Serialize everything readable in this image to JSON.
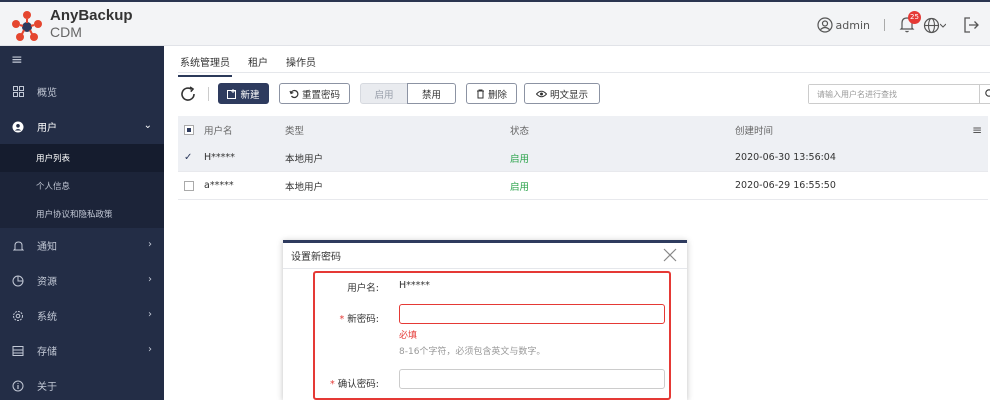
{
  "header": {
    "brand_name": "AnyBackup",
    "brand_sub": "CDM",
    "user": "admin",
    "notification_count": "25"
  },
  "sidebar": {
    "items": [
      {
        "label": "概览",
        "icon": "grid-icon"
      },
      {
        "label": "用户",
        "icon": "user-icon",
        "expanded": true
      },
      {
        "label": "通知",
        "icon": "bell-icon"
      },
      {
        "label": "资源",
        "icon": "pie-chart-icon"
      },
      {
        "label": "系统",
        "icon": "gear-icon"
      },
      {
        "label": "存储",
        "icon": "storage-icon"
      },
      {
        "label": "关于",
        "icon": "info-icon"
      }
    ],
    "sub_items": [
      "用户列表",
      "个人信息",
      "用户协议和隐私政策"
    ],
    "selected_sub": "用户列表"
  },
  "tabs": [
    "系统管理员",
    "租户",
    "操作员"
  ],
  "active_tab": "系统管理员",
  "toolbar": {
    "new_label": "新建",
    "reset_password_label": "重置密码",
    "enable_label": "启用",
    "disable_label": "禁用",
    "delete_label": "删除",
    "show_plain_label": "明文显示",
    "search_placeholder": "请输入用户名进行查找"
  },
  "table": {
    "columns": [
      "用户名",
      "类型",
      "状态",
      "创建时间"
    ],
    "rows": [
      {
        "name": "H*****",
        "type": "本地用户",
        "status": "启用",
        "created": "2020-06-30 13:56:04",
        "selected": true
      },
      {
        "name": "a*****",
        "type": "本地用户",
        "status": "启用",
        "created": "2020-06-29 16:55:50",
        "selected": false
      }
    ]
  },
  "dialog": {
    "title": "设置新密码",
    "username_label": "用户名:",
    "username_value": "H*****",
    "new_password_label": "新密码:",
    "new_password_value": "",
    "required_error": "必填",
    "password_hint": "8-16个字符，必须包含英文与数字。",
    "confirm_password_label": "确认密码:",
    "confirm_password_value": "",
    "required_mark": "*"
  },
  "colors": {
    "sidebar_bg": "#232d46",
    "primary": "#2e3b5e",
    "status_green": "#2aa34a",
    "error_red": "#e53935"
  }
}
